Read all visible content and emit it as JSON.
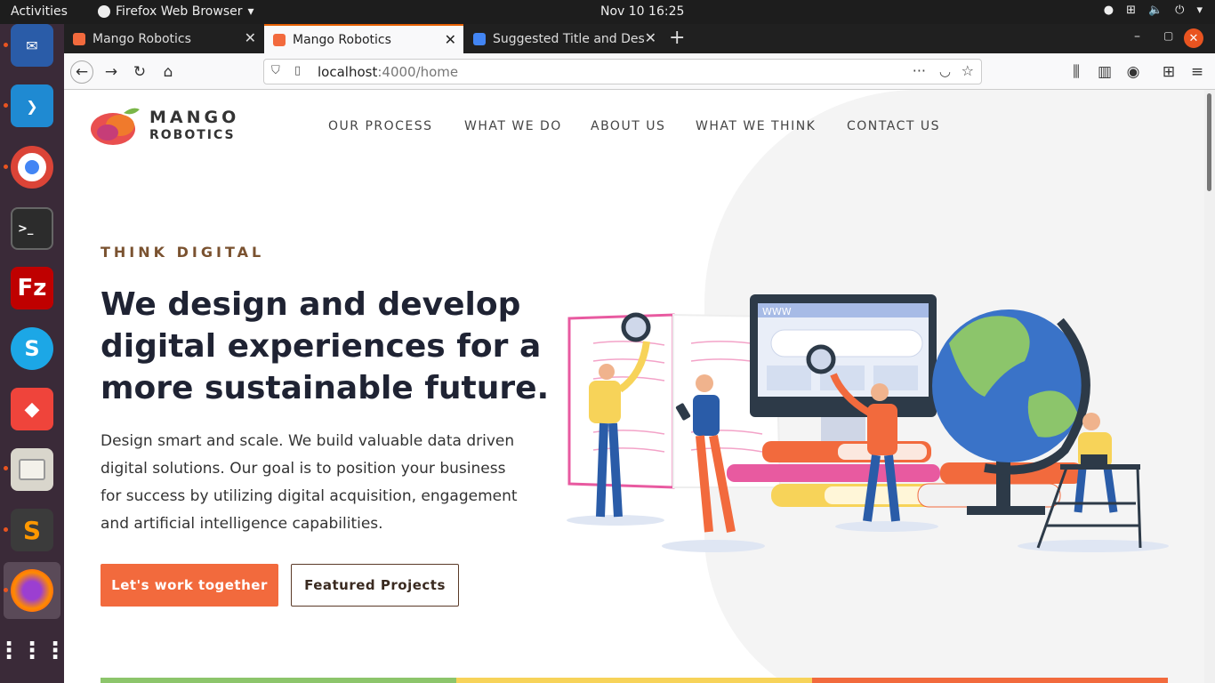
{
  "topbar": {
    "activities": "Activities",
    "app_menu": "Firefox Web Browser",
    "clock": "Nov 10  16:25"
  },
  "browser": {
    "tabs": [
      {
        "label": "Mango Robotics",
        "active": false
      },
      {
        "label": "Mango Robotics",
        "active": true
      },
      {
        "label": "Suggested Title and Desc",
        "active": false
      }
    ],
    "url_host": "localhost",
    "url_path": ":4000/home"
  },
  "page": {
    "logo_line1": "MANGO",
    "logo_line2": "ROBOTICS",
    "nav": [
      "OUR PROCESS",
      "WHAT WE DO",
      "ABOUT US",
      "WHAT WE THINK",
      "CONTACT US"
    ],
    "eyebrow": "THINK DIGITAL",
    "headline": "We design and develop digital experiences for a more sustainable future.",
    "lead": "Design smart and scale. We build valuable data driven digital solutions. Our goal is to position your business for success by utilizing digital acquisition, engagement and artificial intelligence capabilities.",
    "primary_cta": "Let's work together",
    "secondary_cta": "Featured Projects",
    "illustration_browser_label": "WWW"
  },
  "colors": {
    "accent": "#f26a3d",
    "brand_brown": "#7a5230",
    "strip": [
      "#8cc56b",
      "#f7d359",
      "#f26a3d"
    ]
  },
  "icons": {
    "dock": [
      "thunderbird-icon",
      "vscode-icon",
      "chrome-icon",
      "terminal-icon",
      "filezilla-icon",
      "skype-icon",
      "anydesk-icon",
      "files-icon",
      "sublime-icon",
      "firefox-icon",
      "apps-grid-icon"
    ]
  }
}
